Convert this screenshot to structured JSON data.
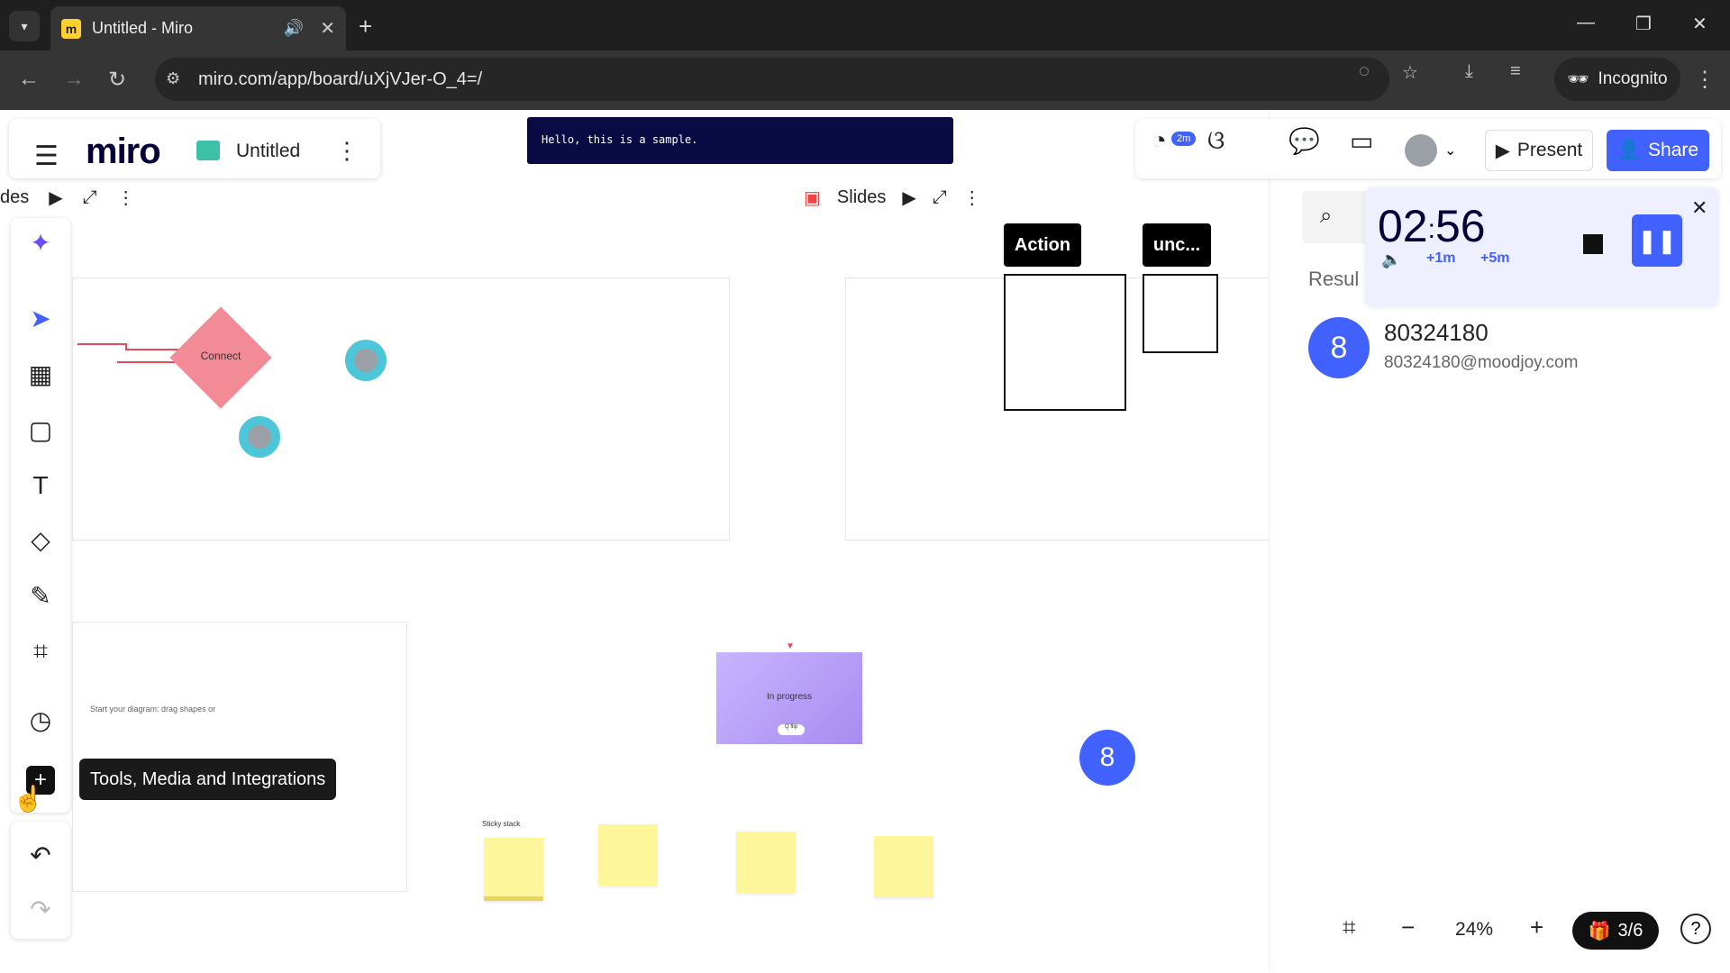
{
  "browser": {
    "tab_title": "Untitled - Miro",
    "favicon_letter": "m",
    "url": "miro.com/app/board/uXjVJer-O_4=/",
    "incognito_label": "Incognito",
    "icons": [
      "tab-search-icon",
      "speaker-icon",
      "close-icon",
      "new-tab-icon",
      "back-icon",
      "forward-icon",
      "reload-icon",
      "site-info-icon",
      "eye-off-icon",
      "star-icon",
      "download-icon",
      "media-icon",
      "incognito-icon",
      "menu-icon",
      "minimize-icon",
      "restore-icon",
      "window-close-icon"
    ]
  },
  "header": {
    "logo": "miro",
    "board_title": "Untitled",
    "sample_text": "Hello, this is a sample.",
    "timer_badge": "2m",
    "present_label": "Present",
    "share_label": "Share"
  },
  "slides": {
    "label": "Slides",
    "left_label": "des"
  },
  "tooltip": "Tools, Media and Integrations",
  "canvas": {
    "connect_label": "Connect",
    "action_label": "Action",
    "unc_label": "unc...",
    "in_progress_label": "In progress",
    "in_progress_chip": "Q flip",
    "sticky_stack_label": "Sticky stack",
    "diagram_hint": "Start your diagram: drag shapes or",
    "canvas_badge": "8"
  },
  "side_panel": {
    "results_label": "Resul",
    "result": {
      "badge": "8",
      "name": "80324180",
      "email": "80324180@moodjoy.com"
    }
  },
  "timer": {
    "minutes": "02",
    "seconds": "56",
    "add1": "+1m",
    "add5": "+5m"
  },
  "zoom": {
    "value": "24%",
    "boards_label": "3/6",
    "help": "?"
  },
  "colors": {
    "accent": "#4262ff",
    "connect_shape": "#f28b96",
    "sticky": "#fff59a",
    "banner": "#0a0a45"
  }
}
